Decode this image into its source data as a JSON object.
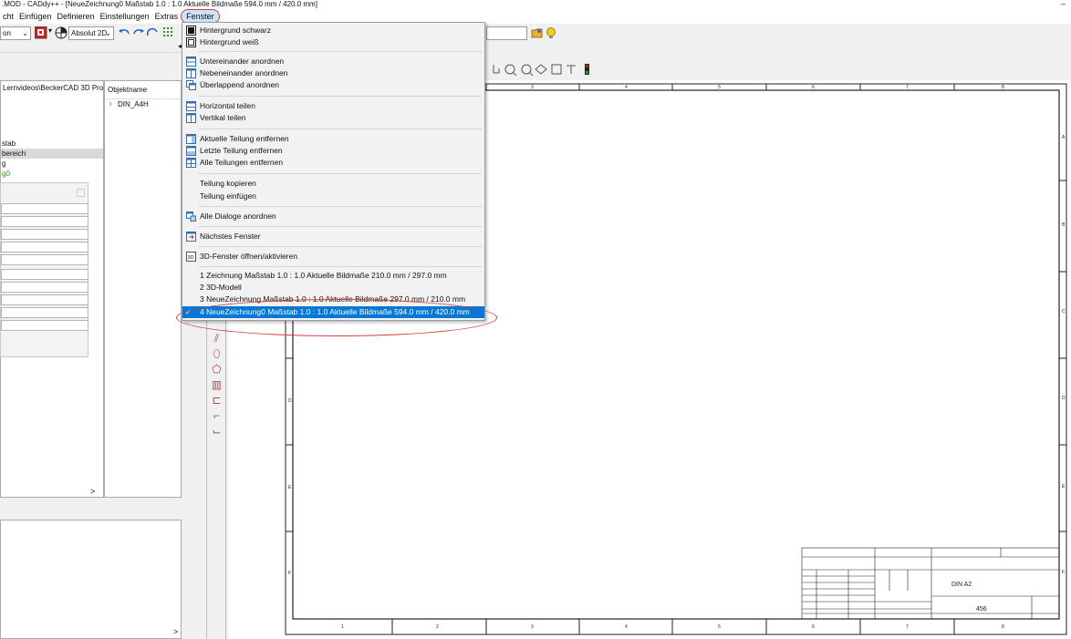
{
  "window": {
    "title": ".MOD  -  CADdy++ - [NeueZeichnung0   Maßstab 1.0 : 1.0   Aktuelle Bildmaße 594.0 mm / 420.0 mm]",
    "minimize": "–"
  },
  "menubar": {
    "items": [
      "cht",
      "Einfügen",
      "Definieren",
      "Einstellungen",
      "Extras",
      "Fenster"
    ]
  },
  "toolbar": {
    "combo1": "on",
    "combo2": "Absolut 2D"
  },
  "left_panel": {
    "path": "Lernvideos\\BeckerCAD 3D Pro",
    "tree": [
      "stab",
      "bereich",
      "g",
      "g0"
    ],
    "scroll_right": ">",
    "scroll_bottom_right": ">"
  },
  "object_panel": {
    "header": "Objektname",
    "item": "DIN_A4H"
  },
  "dropdown": {
    "items": [
      {
        "label": "Hintergrund schwarz",
        "icon": "square-black-icon"
      },
      {
        "label": "Hintergrund weiß",
        "icon": "square-white-icon"
      },
      {
        "label": "Untereinander anordnen",
        "icon": "tile-horizontal-icon"
      },
      {
        "label": "Nebeneinander anordnen",
        "icon": "tile-vertical-icon"
      },
      {
        "label": "Überlappend anordnen",
        "icon": "cascade-icon"
      },
      {
        "label": "Horizontal teilen",
        "icon": "split-horizontal-icon"
      },
      {
        "label": "Vertikal teilen",
        "icon": "split-vertical-icon"
      },
      {
        "label": "Aktuelle Teilung entfernen",
        "icon": "remove-split-icon"
      },
      {
        "label": "Letzte Teilung entfernen",
        "icon": "remove-last-split-icon"
      },
      {
        "label": "Alle Teilungen entfernen",
        "icon": "remove-all-splits-icon"
      },
      {
        "label": "Teilung kopieren",
        "icon": ""
      },
      {
        "label": "Teilung einfügen",
        "icon": ""
      },
      {
        "label": "Alle Dialoge anordnen",
        "icon": "arrange-dialogs-icon"
      },
      {
        "label": "Nächstes Fenster",
        "icon": "next-window-icon"
      },
      {
        "label": "3D-Fenster öffnen/aktivieren",
        "icon": "window-3d-icon"
      },
      {
        "label": "1 Zeichnung    Maßstab 1.0 : 1.0   Aktuelle Bildmaße 210.0 mm / 297.0 mm",
        "icon": ""
      },
      {
        "label": "2 3D-Modell",
        "icon": ""
      },
      {
        "label": "3 NeueZeichnung    Maßstab 1.0 : 1.0   Aktuelle Bildmaße 297.0 mm / 210.0 mm",
        "icon": ""
      },
      {
        "label": "4 NeueZeichnung0    Maßstab 1.0 : 1.0   Aktuelle Bildmaße 594.0 mm / 420.0 mm",
        "icon": ""
      }
    ],
    "check": "✓"
  },
  "drawing": {
    "top_ruler": [
      "3",
      "4",
      "5",
      "6",
      "7",
      "8"
    ],
    "bottom_ruler": [
      "1",
      "2",
      "3",
      "4",
      "5",
      "6",
      "7",
      "8"
    ],
    "right_ruler": [
      "A",
      "B",
      "C",
      "D",
      "E",
      "F"
    ],
    "left_ruler": [
      "D",
      "E",
      "F"
    ],
    "title_block_name": "DIN A2",
    "title_block_number": "456"
  }
}
